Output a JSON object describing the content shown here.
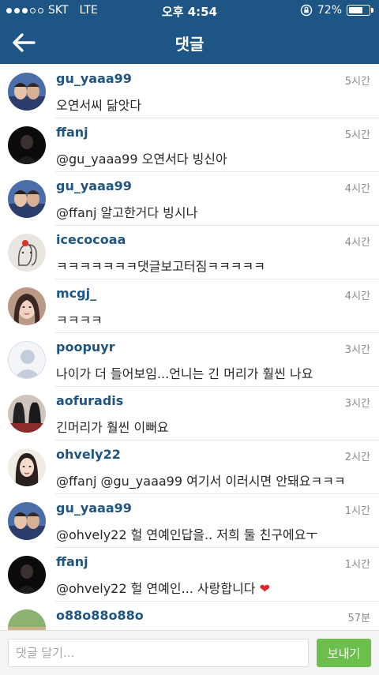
{
  "status_bar": {
    "carrier": "SKT",
    "network": "LTE",
    "time": "오후 4:54",
    "battery": "72%",
    "battery_level": 0.72
  },
  "header": {
    "title": "댓글",
    "back_icon": "arrow-left-icon"
  },
  "colors": {
    "header_bg": "#1d5585",
    "username": "#1f5583",
    "send_button": "#6cbf4c"
  },
  "comments": [
    {
      "username": "gu_yaaa99",
      "time": "5시간",
      "text": "오연서씨 닮앗다"
    },
    {
      "username": "ffanj",
      "time": "5시간",
      "text": "@gu_yaaa99 오연서다 빙신아"
    },
    {
      "username": "gu_yaaa99",
      "time": "4시간",
      "text": "@ffanj 알고한거다 빙시나"
    },
    {
      "username": "icecocoaa",
      "time": "4시간",
      "text": "ㅋㅋㅋㅋㅋㅋㅋ댓글보고터짐ㅋㅋㅋㅋㅋ"
    },
    {
      "username": "mcgj_",
      "time": "4시간",
      "text": "ㅋㅋㅋㅋ"
    },
    {
      "username": "poopuyr",
      "time": "3시간",
      "text": "나이가 더 들어보임...언니는 긴 머리가 훨씬 나요"
    },
    {
      "username": "aofuradis",
      "time": "3시간",
      "text": "긴머리가 훨씬 이뻐요"
    },
    {
      "username": "ohvely22",
      "time": "2시간",
      "text": "@ffanj @gu_yaaa99 여기서 이러시면 안돼요ㅋㅋㅋ"
    },
    {
      "username": "gu_yaaa99",
      "time": "1시간",
      "text": "@ohvely22 헐 연예인답을.. 저희 둘 친구에요ㅜ"
    },
    {
      "username": "ffanj",
      "time": "1시간",
      "text": "@ohvely22 헐 연예인... 사랑합니다 ❤️"
    },
    {
      "username": "o88o88o88o",
      "time": "57분",
      "text": ""
    }
  ],
  "comment_input": {
    "placeholder": "댓글 달기...",
    "value": ""
  },
  "send_button": {
    "label": "보내기"
  }
}
